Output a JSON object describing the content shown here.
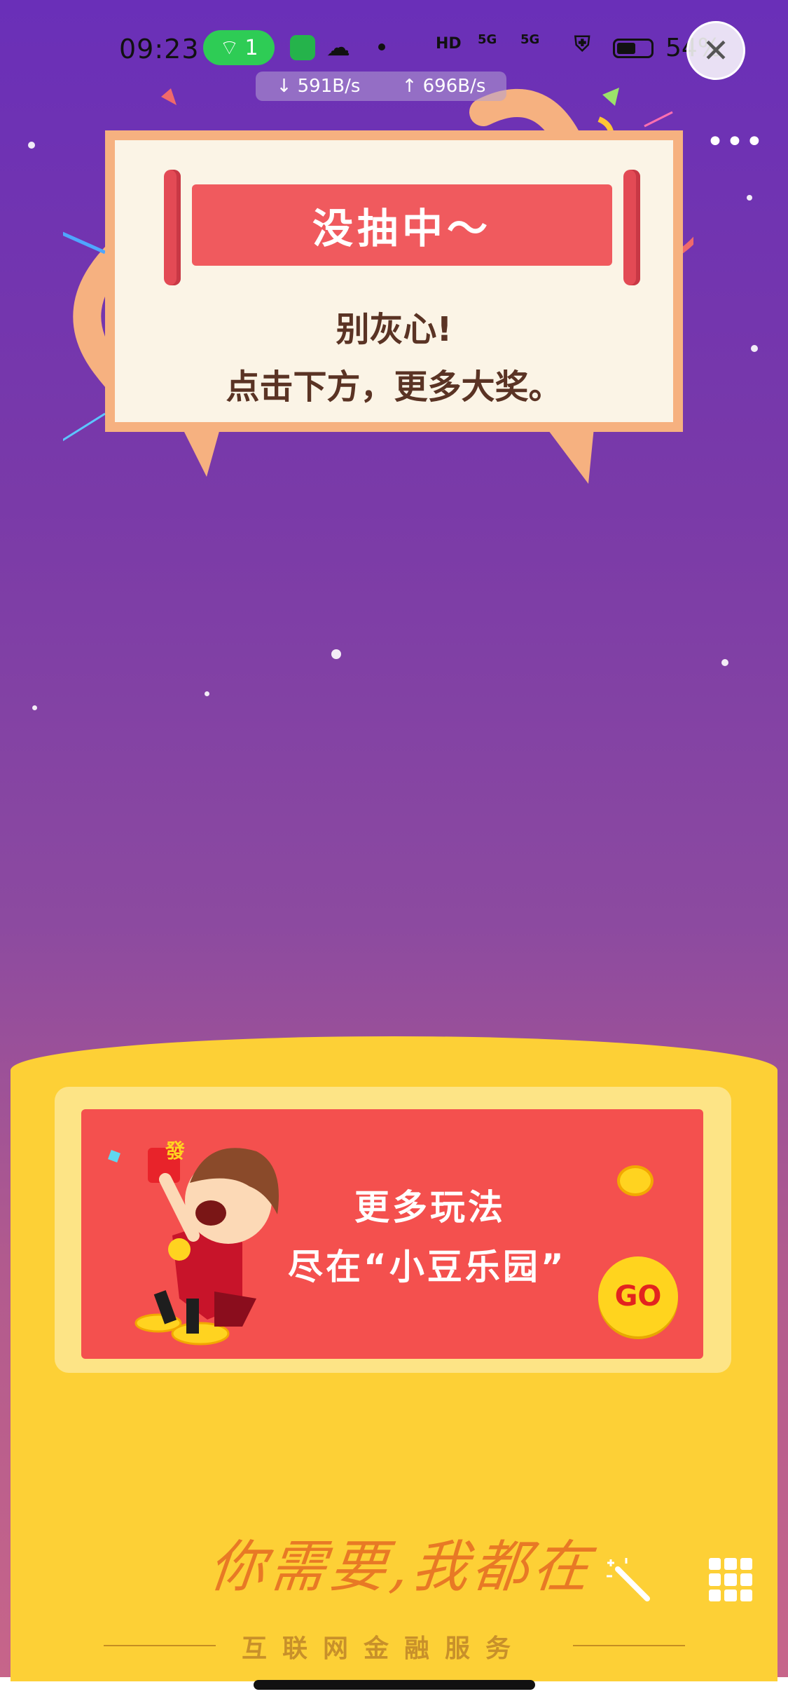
{
  "status_bar": {
    "time": "09:23",
    "hotspot_count": "1",
    "net_download": "↓ 591B/s",
    "net_upload": "↑ 696B/s",
    "battery": "54%",
    "hd_label": "HD",
    "signal_label_1": "5G",
    "signal_label_2": "5G"
  },
  "result_card": {
    "title": "没抽中～",
    "message_line1": "别灰心!",
    "message_line2": "点击下方，更多大奖。"
  },
  "promo_banner": {
    "line1": "更多玩法",
    "line2": "尽在“小豆乐园”",
    "go_label": "GO",
    "badge": "發"
  },
  "footer": {
    "slogan": "你需要,我都在",
    "tagline": "互联网金融服务"
  },
  "colors": {
    "bg_top": "#6a2fb8",
    "card_border": "#f6b180",
    "banner_red": "#f05a5e",
    "yellow": "#fdd036",
    "go_yellow": "#ffd41e"
  },
  "icons": [
    "close-icon",
    "more-icon",
    "wand-icon",
    "grid-icon",
    "wifi-hotspot-icon",
    "wechat-icon",
    "battery-icon"
  ]
}
